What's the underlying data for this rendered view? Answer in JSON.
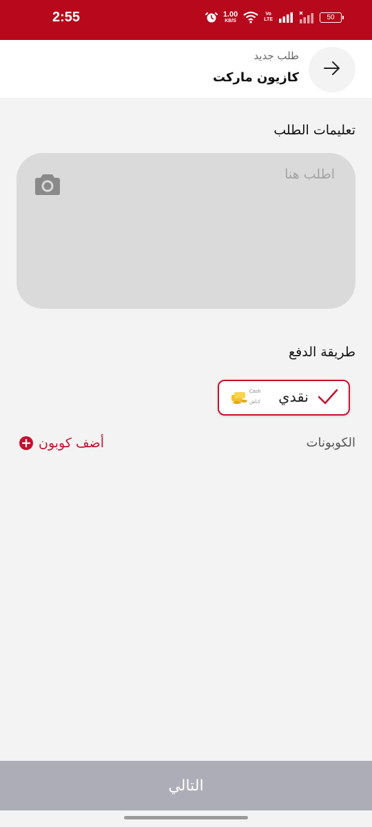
{
  "status_bar": {
    "time": "2:55",
    "net_speed_value": "1.00",
    "net_speed_unit": "KB/S",
    "volte_top": "Vo",
    "volte_bottom": "LTE",
    "battery": "50",
    "colors": {
      "background": "#b8081c"
    },
    "icons": [
      "alarm-icon",
      "wifi-icon",
      "signal-icon",
      "signal-x-icon",
      "battery-icon"
    ]
  },
  "header": {
    "subtitle": "طلب جديد",
    "title": "كازيون ماركت",
    "back_icon": "arrow-right-icon"
  },
  "instructions": {
    "label": "تعليمات الطلب",
    "placeholder": "اطلب هنا",
    "value": "",
    "camera_icon": "camera-icon"
  },
  "payment": {
    "label": "طريقة الدفع",
    "selected_method": {
      "name": "نقدي",
      "caption_en": "Cash",
      "caption_ar": "كـاش",
      "icon": "cash-coins-icon",
      "check_icon": "checkmark-icon",
      "selected": true
    }
  },
  "coupons": {
    "label": "الكوبونات",
    "add_label": "أضف كوبون",
    "add_icon": "plus-circle-icon"
  },
  "footer": {
    "next_label": "التالي"
  },
  "colors": {
    "accent": "#c8102e",
    "page_background": "#f3f3f3",
    "notes_background": "#dadada",
    "next_button_disabled": "#adadb8"
  }
}
